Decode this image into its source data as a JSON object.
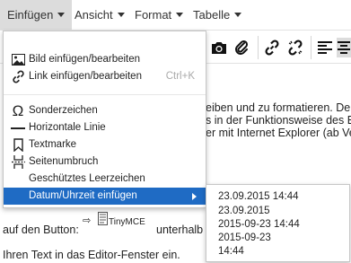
{
  "menubar": {
    "items": [
      "Einfügen",
      "Ansicht",
      "Format",
      "Tabelle"
    ],
    "active_index": 0
  },
  "toolbar": {
    "icons": [
      "camera-icon",
      "paperclip-icon",
      "link-icon",
      "unlink-icon",
      "align-left-icon",
      "align-center-icon"
    ],
    "pressed": "align-center-icon"
  },
  "content": {
    "line1": "eiben und zu formatieren. Der T",
    "line2": "s in der Funktionsweise des Ed",
    "line3": "er mit Internet Explorer (ab Vers",
    "button_prefix": "auf den Button:",
    "button_label": "TinyMCE",
    "after_button": "unterhalb",
    "last_line": "Ihren Text in das Editor-Fenster ein."
  },
  "dropdown": {
    "items": [
      {
        "label": "Bild einfügen/bearbeiten",
        "icon": "image-icon",
        "shortcut": ""
      },
      {
        "label": "Link einfügen/bearbeiten",
        "icon": "link-icon",
        "shortcut": "Ctrl+K"
      },
      {
        "label": "Sonderzeichen",
        "icon": "omega-icon",
        "shortcut": ""
      },
      {
        "label": "Horizontale Linie",
        "icon": "horizontal-line-icon",
        "shortcut": ""
      },
      {
        "label": "Textmarke",
        "icon": "bookmark-icon",
        "shortcut": ""
      },
      {
        "label": "Seitenumbruch",
        "icon": "page-break-icon",
        "shortcut": ""
      },
      {
        "label": "Geschütztes Leerzeichen",
        "icon": "",
        "shortcut": ""
      },
      {
        "label": "Datum/Uhrzeit einfügen",
        "icon": "",
        "shortcut": "",
        "selected": true
      }
    ]
  },
  "submenu": {
    "items": [
      "23.09.2015 14:44",
      "23.09.2015",
      "2015-09-23 14:44",
      "2015-09-23",
      "14:44"
    ]
  },
  "colors": {
    "accent": "#1f6bc4",
    "menubar_active": "#dcdcdc"
  }
}
